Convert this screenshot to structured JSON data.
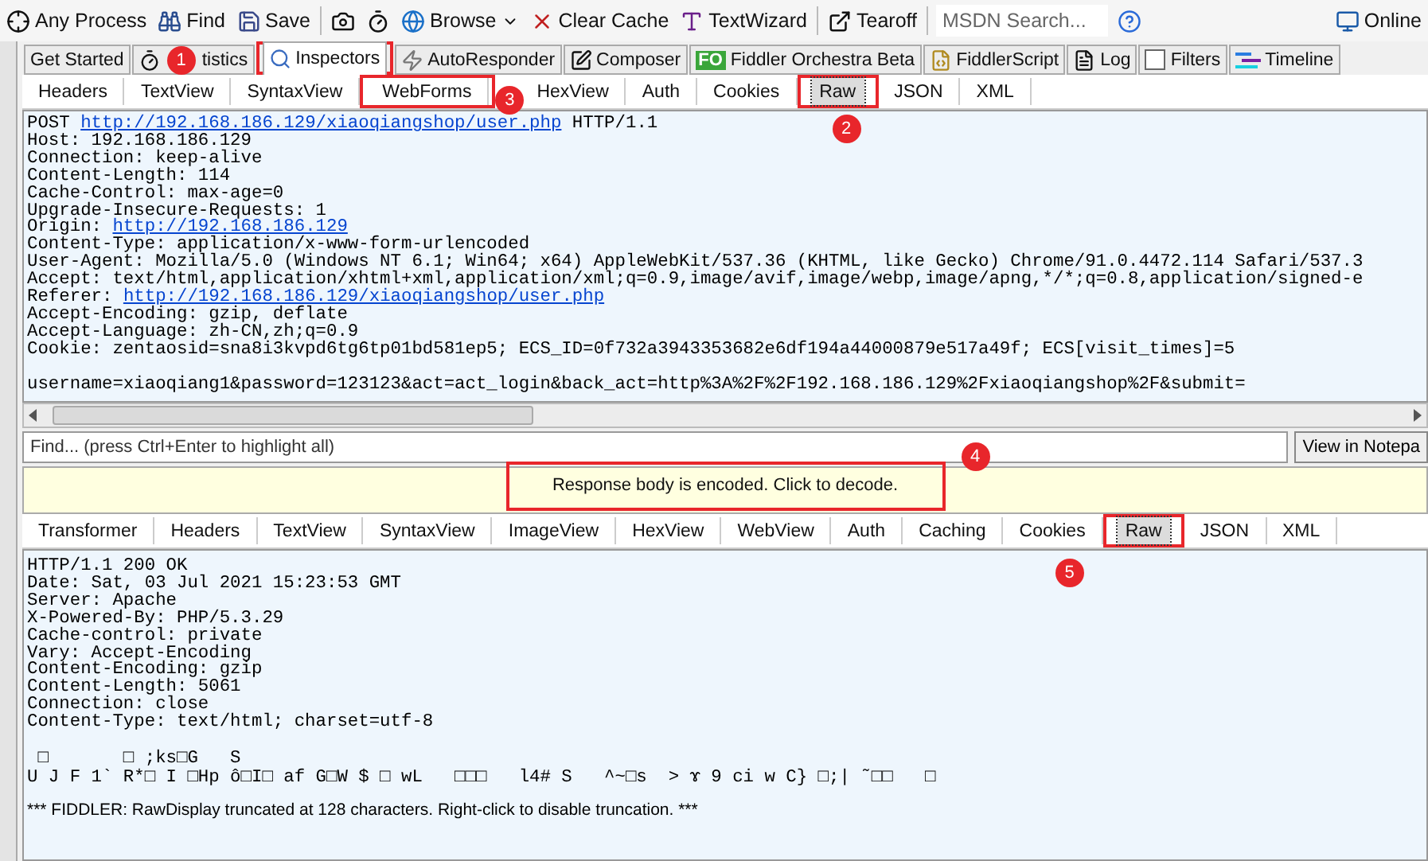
{
  "toolbar": {
    "items": [
      {
        "kind": "button",
        "label": "Any Process"
      },
      {
        "kind": "button",
        "label": "Find"
      },
      {
        "kind": "button",
        "label": "Save"
      },
      {
        "kind": "button"
      },
      {
        "kind": "button"
      },
      {
        "kind": "dropdown",
        "label": "Browse"
      },
      {
        "kind": "button",
        "label": "Clear Cache"
      },
      {
        "kind": "button",
        "label": "TextWizard"
      },
      {
        "kind": "button",
        "label": "Tearoff"
      },
      {
        "kind": "search",
        "placeholder": "MSDN Search..."
      },
      {
        "kind": "button"
      },
      {
        "kind": "button",
        "label": "Online"
      }
    ]
  },
  "main_tabs": [
    {
      "label": "Get Started",
      "selected": false
    },
    {
      "label": "tistics",
      "selected": false
    },
    {
      "label": "Inspectors",
      "selected": true,
      "callout": "1"
    },
    {
      "label": "AutoResponder",
      "selected": false
    },
    {
      "label": "Composer",
      "selected": false
    },
    {
      "label": "Fiddler Orchestra Beta",
      "badge": "FO",
      "selected": false
    },
    {
      "label": "FiddlerScript",
      "selected": false
    },
    {
      "label": "Log",
      "selected": false
    },
    {
      "label": "Filters",
      "selected": false
    },
    {
      "label": "Timeline",
      "selected": false
    }
  ],
  "request": {
    "tabs": [
      {
        "label": "Headers",
        "selected": false
      },
      {
        "label": "TextView",
        "selected": false
      },
      {
        "label": "SyntaxView",
        "selected": false
      },
      {
        "label": "WebForms",
        "selected": false,
        "callout": "3"
      },
      {
        "label": "HexView",
        "selected": false
      },
      {
        "label": "Auth",
        "selected": false
      },
      {
        "label": "Cookies",
        "selected": false
      },
      {
        "label": "Raw",
        "selected": true,
        "callout": "2"
      },
      {
        "label": "JSON",
        "selected": false
      },
      {
        "label": "XML",
        "selected": false
      }
    ],
    "lines": [
      {
        "text": "POST ",
        "link": "http://192.168.186.129/xiaoqiangshop/user.php",
        "after": " HTTP/1.1"
      },
      {
        "text": "Host: 192.168.186.129"
      },
      {
        "text": "Connection: keep-alive"
      },
      {
        "text": "Content-Length: 114"
      },
      {
        "text": "Cache-Control: max-age=0"
      },
      {
        "text": "Upgrade-Insecure-Requests: 1"
      },
      {
        "text": "Origin: ",
        "link": "http://192.168.186.129"
      },
      {
        "text": "Content-Type: application/x-www-form-urlencoded"
      },
      {
        "text": "User-Agent: Mozilla/5.0 (Windows NT 6.1; Win64; x64) AppleWebKit/537.36 (KHTML, like Gecko) Chrome/91.0.4472.114 Safari/537.3"
      },
      {
        "text": "Accept: text/html,application/xhtml+xml,application/xml;q=0.9,image/avif,image/webp,image/apng,*/*;q=0.8,application/signed-e"
      },
      {
        "text": "Referer: ",
        "link": "http://192.168.186.129/xiaoqiangshop/user.php"
      },
      {
        "text": "Accept-Encoding: gzip, deflate"
      },
      {
        "text": "Accept-Language: zh-CN,zh;q=0.9"
      },
      {
        "text": "Cookie: zentaosid=sna8i3kvpd6tg6tp01bd581ep5; ECS_ID=0f732a3943353682e6df194a44000879e517a49f; ECS[visit_times]=5"
      },
      {
        "gap_before": true,
        "text": "username=xiaoqiang1&password=123123&act=act_login&back_act=http%3A%2F%2F192.168.186.129%2Fxiaoqiangshop%2F&submit="
      }
    ],
    "find": {
      "placeholder": "Find... (press Ctrl+Enter to highlight all)"
    },
    "notepad_button": "View in Notepa"
  },
  "notice": {
    "text": "Response body is encoded. Click to decode.",
    "callout": "4"
  },
  "response": {
    "tabs": [
      {
        "label": "Transformer",
        "selected": false
      },
      {
        "label": "Headers",
        "selected": false
      },
      {
        "label": "TextView",
        "selected": false
      },
      {
        "label": "SyntaxView",
        "selected": false
      },
      {
        "label": "ImageView",
        "selected": false
      },
      {
        "label": "HexView",
        "selected": false
      },
      {
        "label": "WebView",
        "selected": false
      },
      {
        "label": "Auth",
        "selected": false
      },
      {
        "label": "Caching",
        "selected": false
      },
      {
        "label": "Cookies",
        "selected": false
      },
      {
        "label": "Raw",
        "selected": true,
        "callout": "5"
      },
      {
        "label": "JSON",
        "selected": false
      },
      {
        "label": "XML",
        "selected": false
      }
    ],
    "lines": [
      "HTTP/1.1 200 OK",
      "Date: Sat, 03 Jul 2021 15:23:53 GMT",
      "Server: Apache",
      "X-Powered-By: PHP/5.3.29",
      "Cache-control: private",
      "Vary: Accept-Encoding",
      "Content-Encoding: gzip",
      "Content-Length: 5061",
      "Connection: close",
      "Content-Type: text/html; charset=utf-8"
    ],
    "body_lines": [
      " □       □ ;ks□G   S",
      "U J F 1` R*□ I □Hp ô□I□ af G□W $ □ wL   □□□   l4# S   ^~□s  > ɤ 9 ci w C} □;| ˜□□   □"
    ],
    "footer": "*** FIDDLER: RawDisplay truncated at 128 characters. Right-click to disable truncation. ***"
  }
}
